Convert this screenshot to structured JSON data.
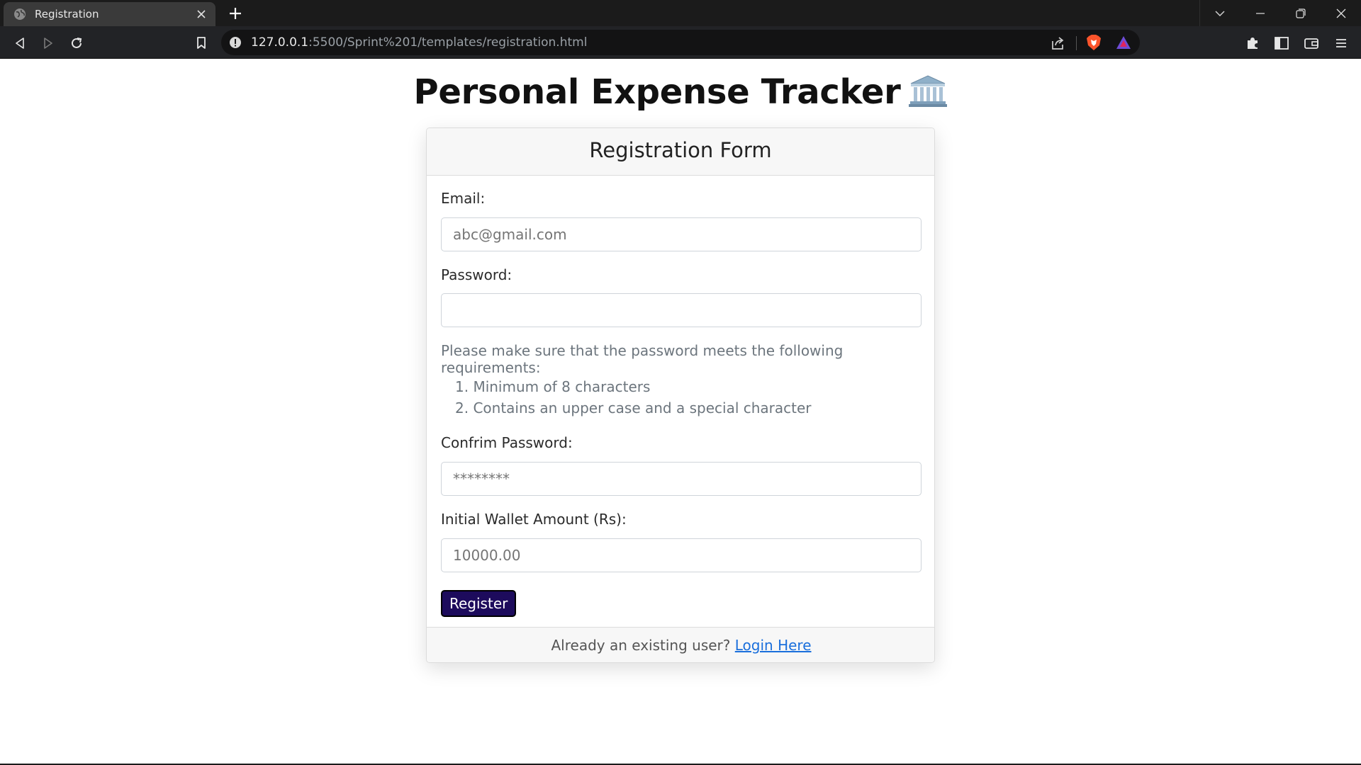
{
  "browser": {
    "tab_title": "Registration",
    "url_host": "127.0.0.1",
    "url_rest": ":5500/Sprint%201/templates/registration.html"
  },
  "page": {
    "title": "Personal Expense Tracker",
    "title_icon": "classical-building-icon"
  },
  "form": {
    "header": "Registration Form",
    "email_label": "Email:",
    "email_placeholder": "abc@gmail.com",
    "password_label": "Password:",
    "password_value": "",
    "requirements_intro": "Please make sure that the password meets the following requirements:",
    "requirements": [
      "1. Minimum of 8 characters",
      "2. Contains an upper case and a special character"
    ],
    "confirm_label": "Confrim Password:",
    "confirm_placeholder": "********",
    "wallet_label": "Initial Wallet Amount (Rs):",
    "wallet_placeholder": "10000.00",
    "register_label": "Register",
    "footer_text": "Already an existing user?",
    "login_link": "Login Here"
  },
  "colors": {
    "register_button": "#1d0b5c",
    "link": "#1a6fdc",
    "muted_text": "#6c757d"
  }
}
